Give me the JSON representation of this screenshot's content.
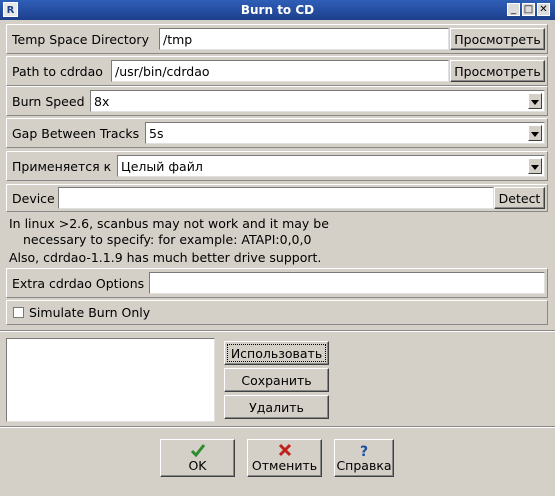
{
  "window": {
    "title": "Burn to CD",
    "icon": "app-icon",
    "controls": [
      "minimize",
      "maximize",
      "close"
    ]
  },
  "temp_dir": {
    "label": "Temp Space Directory",
    "value": "/tmp",
    "browse": "Просмотреть"
  },
  "cdrdao_path": {
    "label": "Path to cdrdao",
    "value": "/usr/bin/cdrdao",
    "browse": "Просмотреть"
  },
  "burn_speed": {
    "label": "Burn Speed",
    "value": "8x"
  },
  "gap": {
    "label": "Gap Between Tracks",
    "value": "5s"
  },
  "apply_to": {
    "label": "Применяется к",
    "value": "Целый файл"
  },
  "device": {
    "label": "Device",
    "value": "",
    "detect": "Detect"
  },
  "info": {
    "line1": "In linux >2.6, scanbus may not work and it may be",
    "line2": "necessary to specify: for example: ATAPI:0,0,0",
    "line3": "Also, cdrdao-1.1.9 has much better drive support."
  },
  "extra": {
    "label": "Extra cdrdao Options",
    "value": ""
  },
  "simulate": {
    "label": "Simulate Burn Only",
    "checked": false
  },
  "presets": {
    "items": [],
    "use": "Использовать",
    "save": "Сохранить",
    "delete": "Удалить"
  },
  "footer": {
    "ok": "OK",
    "cancel": "Отменить",
    "help": "Справка"
  }
}
